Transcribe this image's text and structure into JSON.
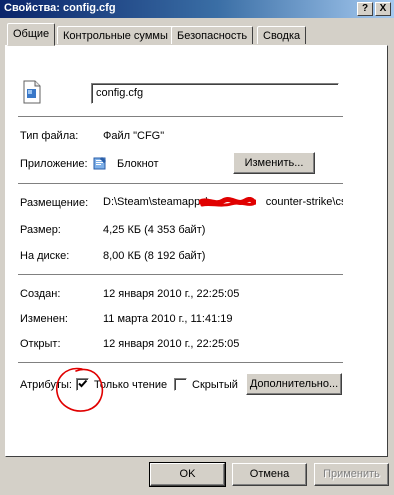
{
  "window": {
    "title": "Свойства: config.cfg",
    "help_label": "?",
    "close_label": "X"
  },
  "tabs": [
    {
      "label": "Общие",
      "active": true
    },
    {
      "label": "Контрольные суммы",
      "active": false
    },
    {
      "label": "Безопасность",
      "active": false
    },
    {
      "label": "Сводка",
      "active": false
    }
  ],
  "general": {
    "file_name": "config.cfg",
    "type_label": "Тип файла:",
    "type_value": "Файл \"CFG\"",
    "app_label": "Приложение:",
    "app_value": "Блокнот",
    "change_button": "Изменить...",
    "location_label": "Размещение:",
    "location_value_start": "D:\\Steam\\steamapps\\",
    "location_value_end": "counter-strike\\cstr",
    "size_label": "Размер:",
    "size_value": "4,25 КБ (4 353 байт)",
    "disk_size_label": "На диске:",
    "disk_size_value": "8,00 КБ (8 192 байт)",
    "created_label": "Создан:",
    "created_value": "12 января 2010 г., 22:25:05",
    "modified_label": "Изменен:",
    "modified_value": "11 марта 2010 г., 11:41:19",
    "opened_label": "Открыт:",
    "opened_value": "12 января 2010 г., 22:25:05",
    "attributes_label": "Атрибуты:",
    "readonly_label": "Только чтение",
    "readonly_checked": true,
    "hidden_label": "Скрытый",
    "hidden_checked": false,
    "advanced_button": "Дополнительно..."
  },
  "buttons": {
    "ok": "OK",
    "cancel": "Отмена",
    "apply": "Применить"
  },
  "colors": {
    "titlebar_start": "#0a246a",
    "titlebar_end": "#a6caf0",
    "face": "#d4d0c8",
    "annotation_red": "#e00000"
  }
}
